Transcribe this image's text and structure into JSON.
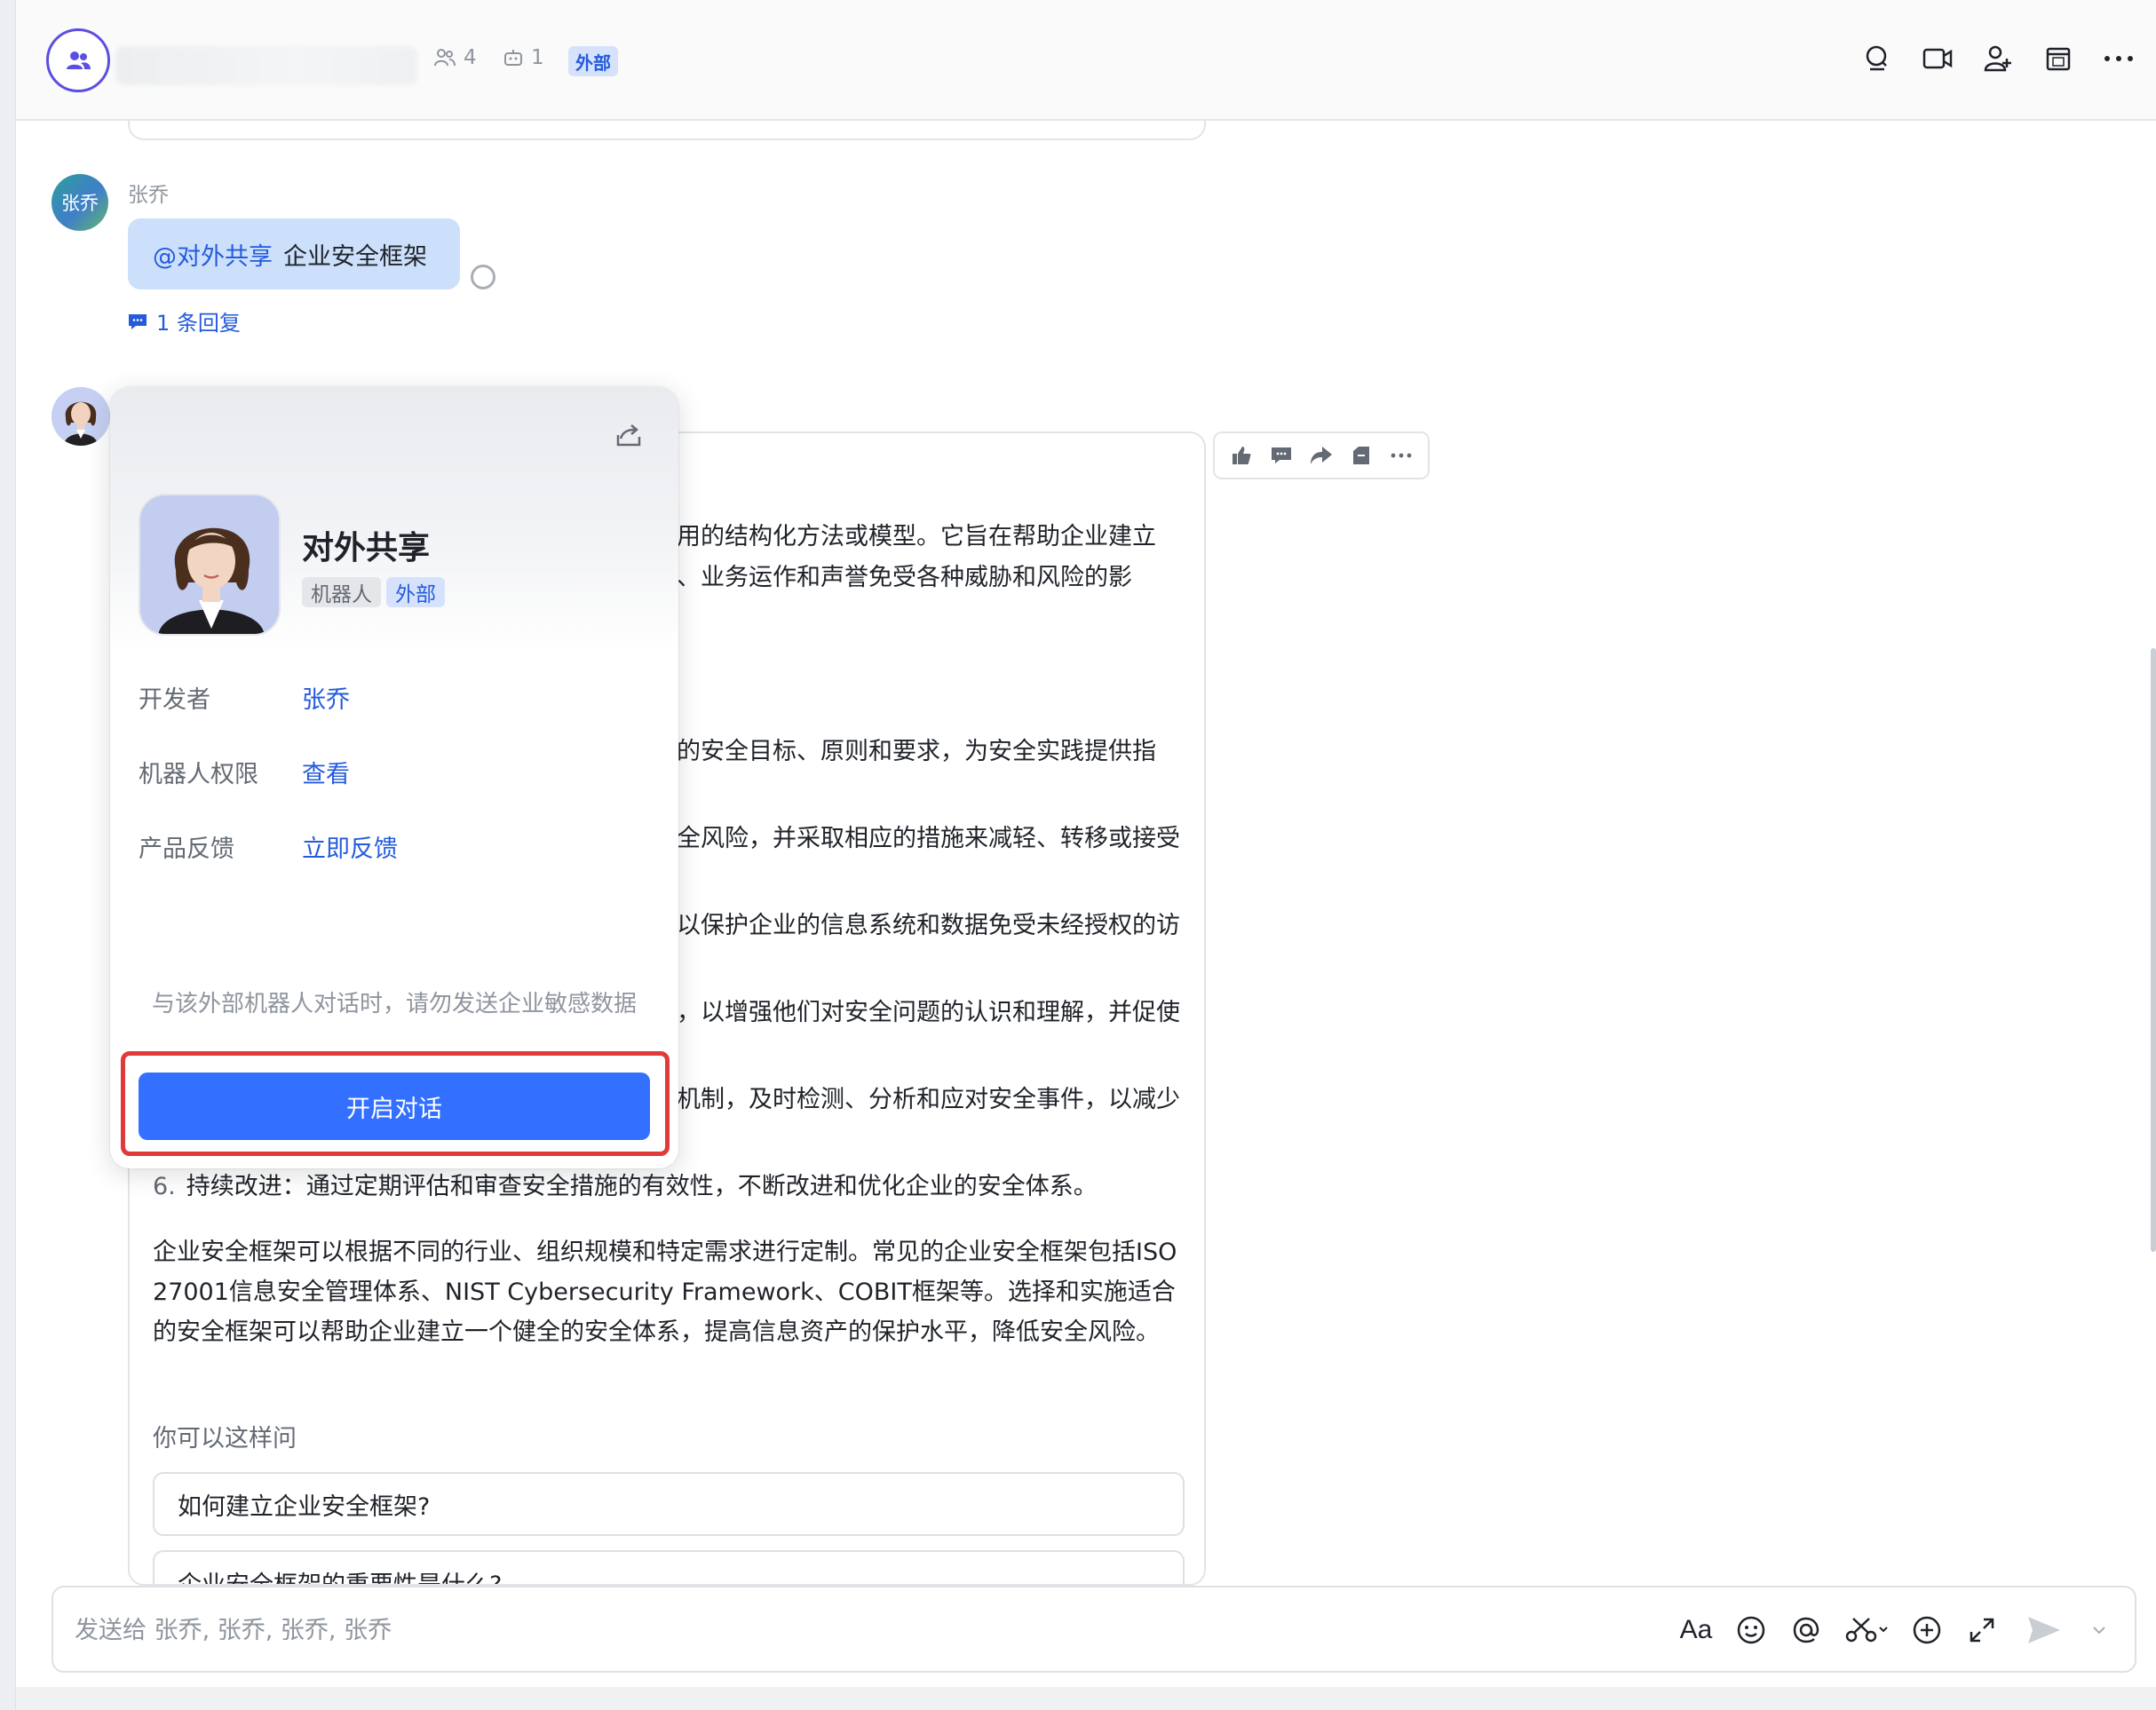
{
  "header": {
    "member_count": "4",
    "bot_count": "1",
    "external_tag": "外部"
  },
  "message1": {
    "sender": "张乔",
    "avatar_text": "张乔",
    "mention": "@对外共享",
    "text": "企业安全框架",
    "reply_link": "1 条回复"
  },
  "bot_message": {
    "lines": [
      "用的结构化方法或模型。它旨在帮助企业建立",
      "、业务运作和声誉免受各种威胁和风险的影",
      "的安全目标、原则和要求，为安全实践提供指",
      "全风险，并采取相应的措施来减轻、转移或接受",
      "以保护企业的信息系统和数据免受未经授权的访",
      "，以增强他们对安全问题的认识和理解，并促使",
      "机制，及时检测、分析和应对安全事件，以减少"
    ],
    "item6_num": "6.",
    "item6_text": "持续改进：通过定期评估和审查安全措施的有效性，不断改进和优化企业的安全体系。",
    "summary": "企业安全框架可以根据不同的行业、组织规模和特定需求进行定制。常见的企业安全框架包括ISO 27001信息安全管理体系、NIST Cybersecurity Framework、COBIT框架等。选择和实施适合的安全框架可以帮助企业建立一个健全的安全体系，提高信息资产的保护水平，降低安全风险。",
    "hint_label": "你可以这样问",
    "suggestions": [
      "如何建立企业安全框架?",
      "企业安全框架的重要性是什么?"
    ]
  },
  "profile_card": {
    "name": "对外共享",
    "tag_bot": "机器人",
    "tag_external": "外部",
    "developer_label": "开发者",
    "developer_value": "张乔",
    "permission_label": "机器人权限",
    "permission_value": "查看",
    "feedback_label": "产品反馈",
    "feedback_value": "立即反馈",
    "warning": "与该外部机器人对话时，请勿发送企业敏感数据",
    "start_button": "开启对话"
  },
  "composer": {
    "placeholder": "发送给 张乔, 张乔, 张乔, 张乔",
    "format_label": "Aa"
  },
  "colors": {
    "accent": "#3370ff",
    "link": "#245bdb",
    "highlight": "#e03a3a",
    "group_avatar_ring": "#5b4ee2"
  },
  "icons": [
    "group-icon",
    "members-icon",
    "bot-icon",
    "search-icon",
    "video-call-icon",
    "add-member-icon",
    "calendar-icon",
    "more-icon",
    "thumbs-up-icon",
    "comment-icon",
    "forward-icon",
    "pin-icon",
    "share-icon",
    "emoji-icon",
    "at-icon",
    "scissors-icon",
    "add-icon",
    "expand-icon",
    "send-icon"
  ]
}
